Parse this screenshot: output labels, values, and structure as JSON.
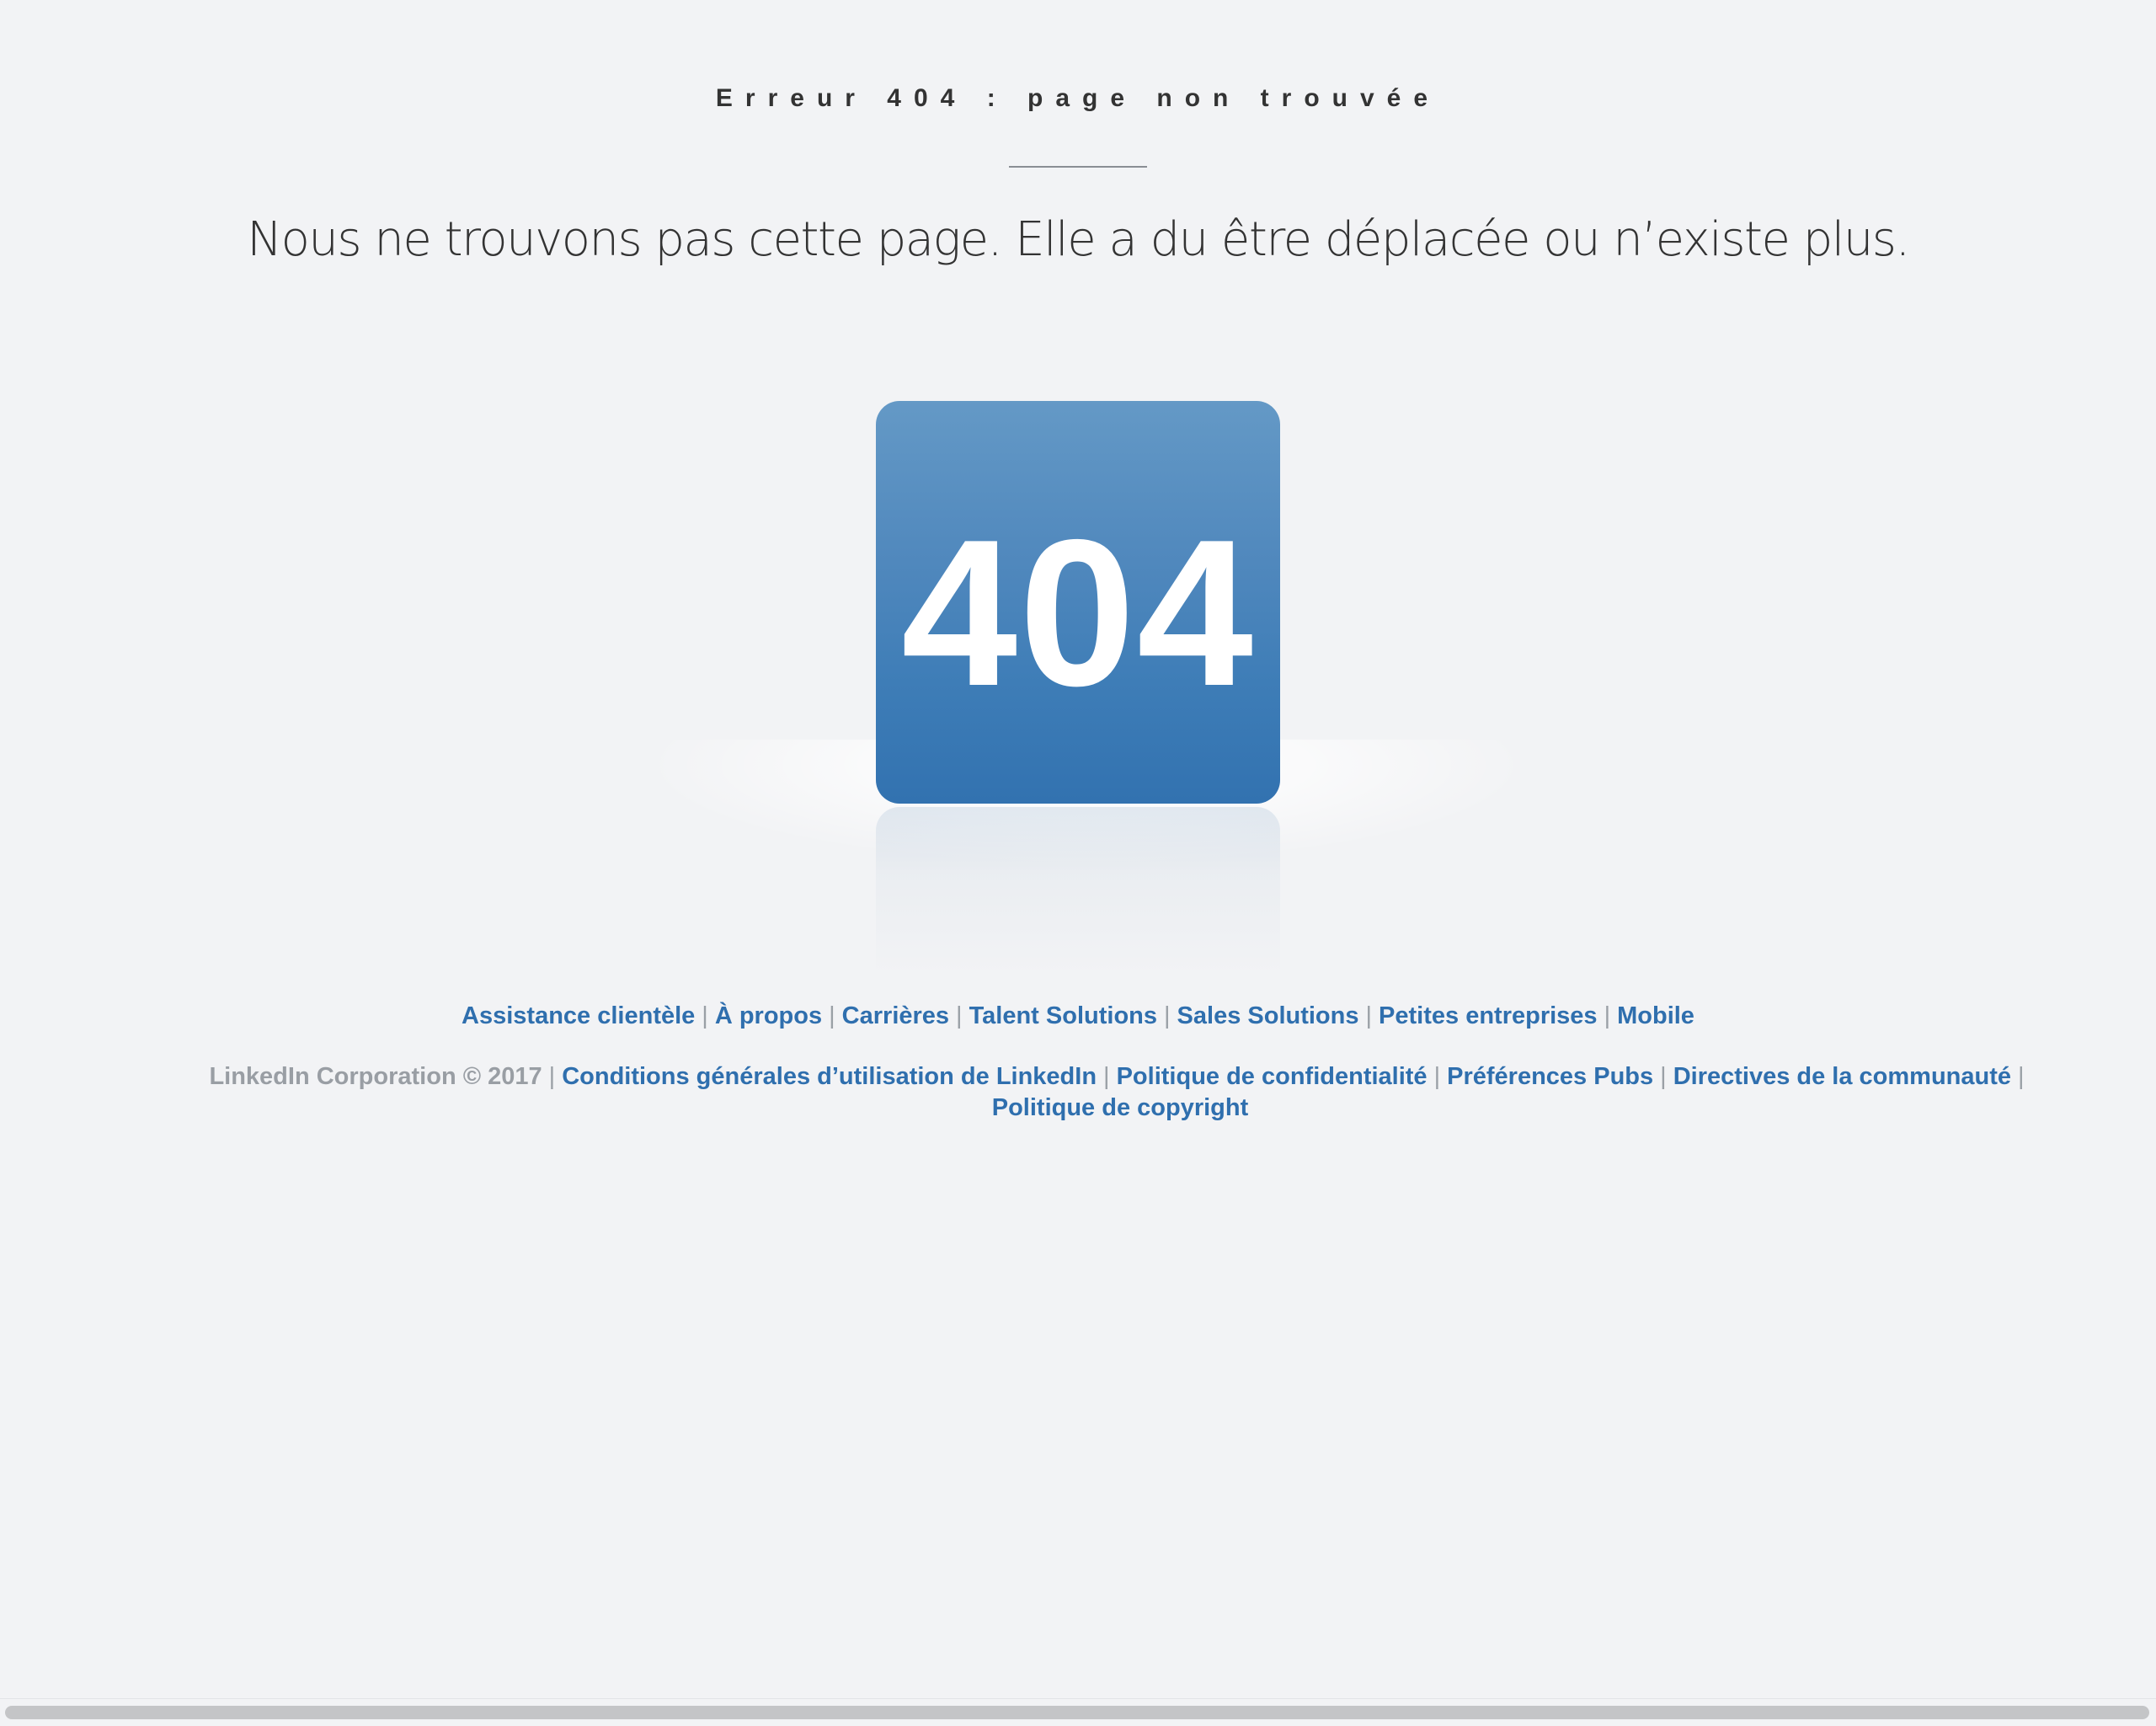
{
  "error": {
    "heading": "Erreur 404 : page non trouvée",
    "message": "Nous ne trouvons pas cette page. Elle a du être déplacée ou n’existe plus.",
    "code": "404"
  },
  "footer": {
    "separator": "|",
    "links": [
      "Assistance clientèle",
      "À propos",
      "Carrières",
      "Talent Solutions",
      "Sales Solutions",
      "Petites entreprises",
      "Mobile"
    ],
    "copyright": "LinkedIn Corporation © 2017",
    "legal_links": [
      "Conditions générales d’utilisation de LinkedIn",
      "Politique de confidentialité",
      "Préférences Pubs",
      "Directives de la communauté",
      "Politique de copyright"
    ]
  },
  "colors": {
    "background": "#f2f3f5",
    "tile_top": "#6499c6",
    "tile_bottom": "#3272b0",
    "link": "#2f6fae",
    "muted": "#999ea4"
  }
}
